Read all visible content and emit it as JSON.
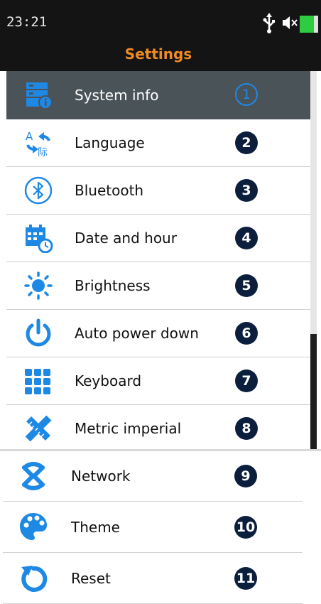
{
  "status": {
    "time": "23:21",
    "title": "Settings"
  },
  "menu": [
    {
      "label": "System info",
      "number": "1",
      "icon": "system-info-icon"
    },
    {
      "label": "Language",
      "number": "2",
      "icon": "language-icon"
    },
    {
      "label": "Bluetooth",
      "number": "3",
      "icon": "bluetooth-icon"
    },
    {
      "label": "Date and hour",
      "number": "4",
      "icon": "calendar-clock-icon"
    },
    {
      "label": "Brightness",
      "number": "5",
      "icon": "brightness-icon"
    },
    {
      "label": "Auto power down",
      "number": "6",
      "icon": "power-icon"
    },
    {
      "label": "Keyboard",
      "number": "7",
      "icon": "keyboard-icon"
    },
    {
      "label": "Metric imperial",
      "number": "8",
      "icon": "ruler-icon"
    },
    {
      "label": "Network",
      "number": "9",
      "icon": "network-icon"
    },
    {
      "label": "Theme",
      "number": "10",
      "icon": "palette-icon"
    },
    {
      "label": "Reset",
      "number": "11",
      "icon": "reset-icon"
    }
  ],
  "colors": {
    "accent": "#1e88e5",
    "title": "#f08a24",
    "selected_row": "#4a5358",
    "battery": "#2ecc40"
  }
}
